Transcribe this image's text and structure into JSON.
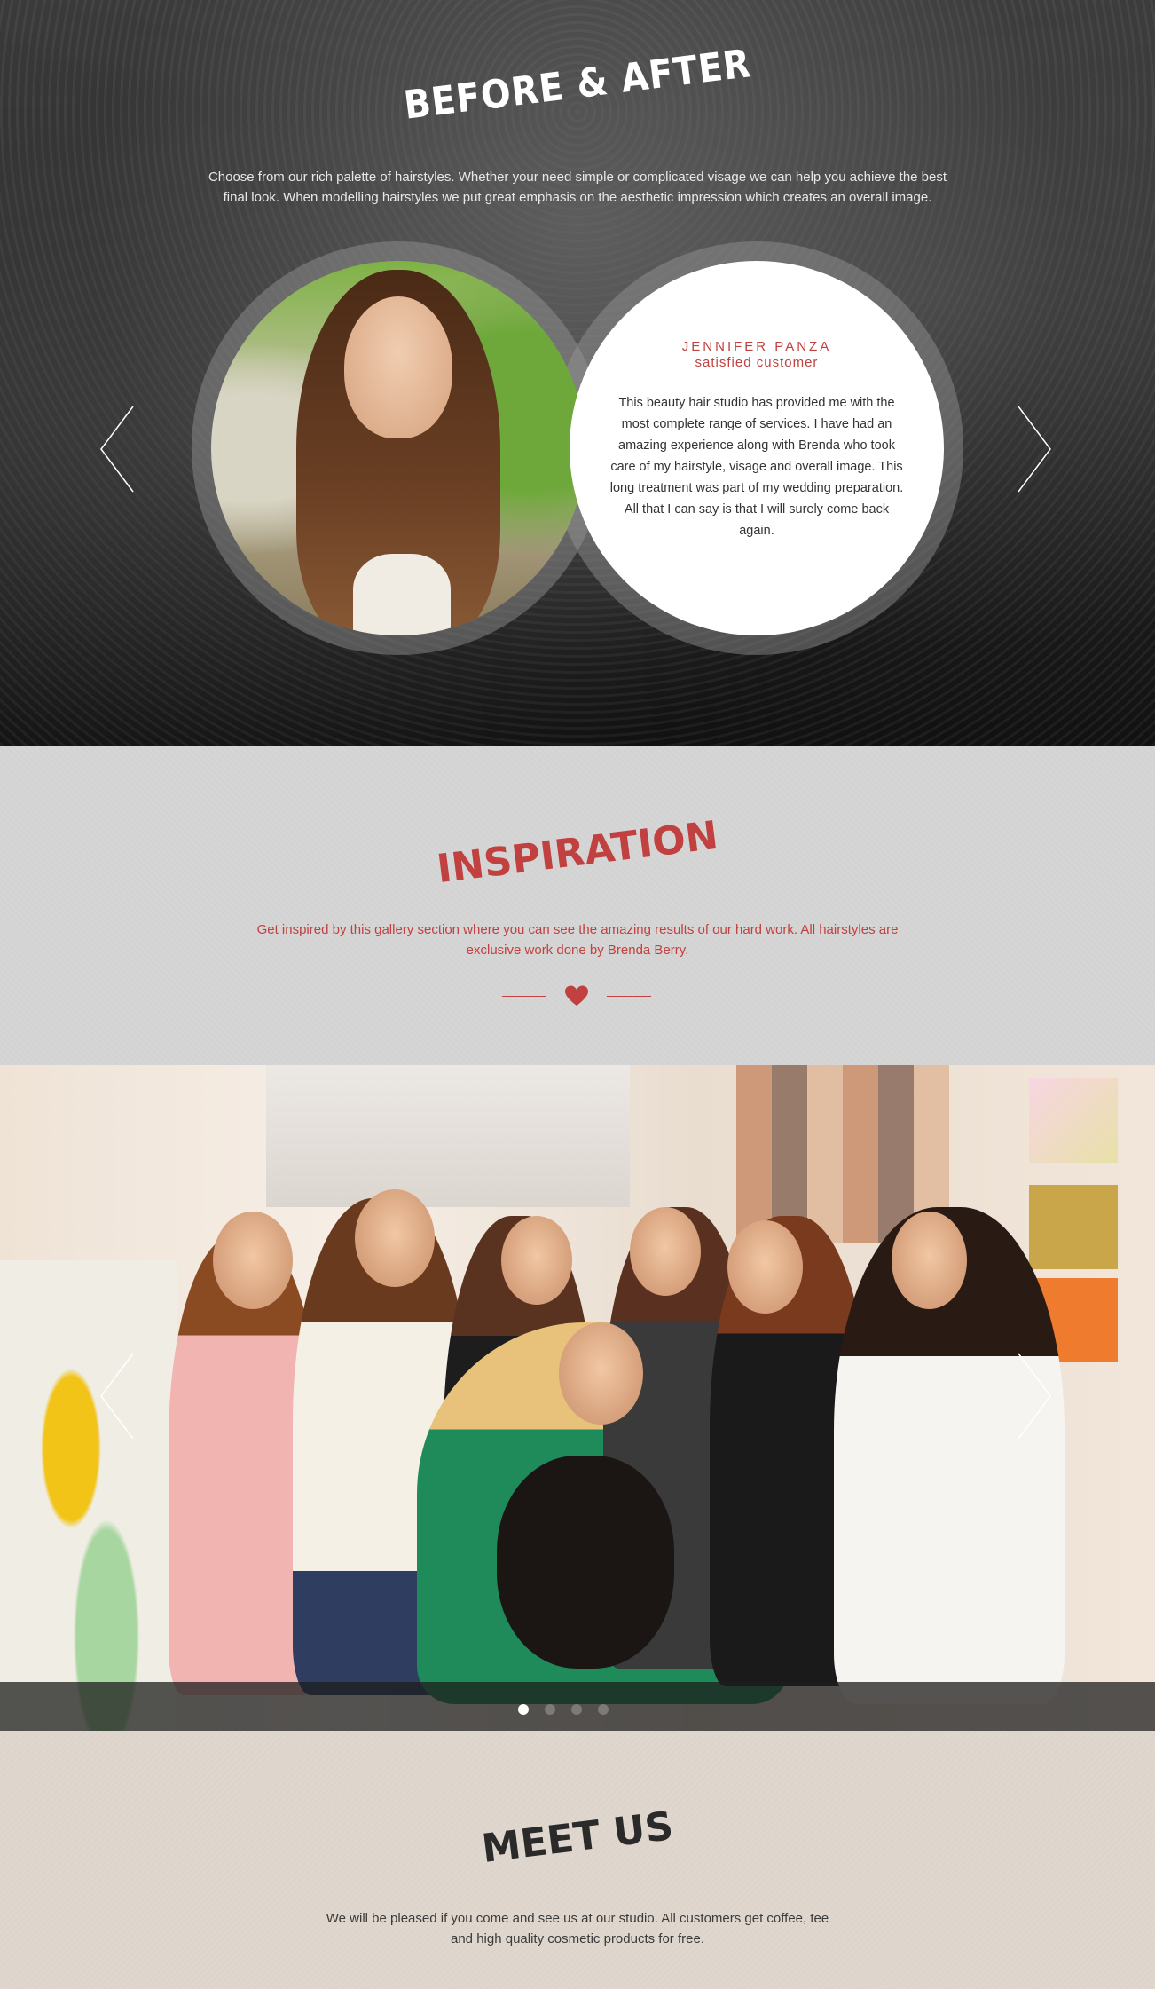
{
  "before_after": {
    "title": "BEFORE & AFTER",
    "description": "Choose from our rich palette of hairstyles. Whether your need simple or complicated visage we can help you achieve the best final look. When modelling hairstyles we put great emphasis on the aesthetic impression which creates an overall image.",
    "testimonial": {
      "name": "JENNIFER  PANZA",
      "role": "satisfied customer",
      "quote": "This beauty hair studio has provided me with the most complete range of services. I have had an amazing experience along with Brenda who took care of my hairstyle, visage and overall image. This long treatment was part of my wedding preparation.  All that I can say is that I will surely come back again."
    },
    "prev_icon": "chevron-left-icon",
    "next_icon": "chevron-right-icon"
  },
  "inspiration": {
    "title": "INSPIRATION",
    "description": "Get inspired by this gallery section where you can see the amazing results of our hard work. All hairstyles are exclusive work done by Brenda Berry.",
    "divider_icon": "heart-icon"
  },
  "gallery": {
    "slide_count": 4,
    "active_slide": 1,
    "prev_icon": "chevron-left-icon",
    "next_icon": "chevron-right-icon"
  },
  "meet_us": {
    "title": "MEET US",
    "description": "We will be pleased if you come and see us at our studio. All customers get coffee, tee and high quality cosmetic products for free."
  },
  "colors": {
    "accent": "#c0413f",
    "dark_text": "#2a2a2a"
  }
}
